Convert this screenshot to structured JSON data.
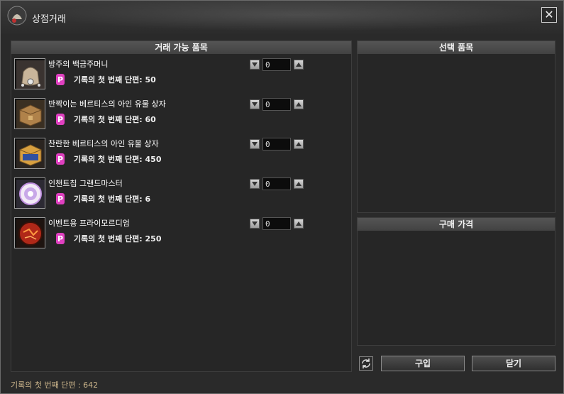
{
  "window": {
    "title": "상점거래",
    "close_label": "✕"
  },
  "left_panel": {
    "header": "거래 가능 품목",
    "items": [
      {
        "name": "방주의 백금주머니",
        "price_label": "기록의 첫 번째 단편",
        "price": "50",
        "qty": "0",
        "icon": "coin-pouch-icon"
      },
      {
        "name": "반짝이는 베르티스의 아인 유물 상자",
        "price_label": "기록의 첫 번째 단편",
        "price": "60",
        "qty": "0",
        "icon": "relic-chest-icon"
      },
      {
        "name": "찬란한 베르티스의 아인 유물 상자",
        "price_label": "기록의 첫 번째 단편",
        "price": "450",
        "qty": "0",
        "icon": "ornate-chest-icon"
      },
      {
        "name": "인챈트칩 그랜드마스터",
        "price_label": "기록의 첫 번째 단편",
        "price": "6",
        "qty": "0",
        "icon": "enchant-chip-icon"
      },
      {
        "name": "이벤트용 프라이모르디엄",
        "price_label": "기록의 첫 번째 단편",
        "price": "250",
        "qty": "0",
        "icon": "primordium-orb-icon"
      }
    ]
  },
  "right_panel": {
    "selected_header": "선택 품목",
    "price_header": "구매 가격"
  },
  "buttons": {
    "buy": "구입",
    "close": "닫기"
  },
  "footer": {
    "label": "기록의 첫 번째 단편 :",
    "value": "642"
  },
  "colors": {
    "point_icon": "#e040c0",
    "footer_text": "#c9b38a"
  }
}
